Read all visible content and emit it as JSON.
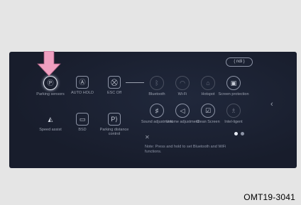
{
  "top_button": "( ndi )",
  "left_items": [
    {
      "name": "parking-sensor",
      "icon": "parking-icon",
      "glyph": "Ⓟ",
      "label": "Parking sensors",
      "highlight": true
    },
    {
      "name": "auto-hold",
      "icon": "auto-hold-icon",
      "glyph": "Ⓐ",
      "label": "AUTO HOLD"
    },
    {
      "name": "esc-off",
      "icon": "esc-off-icon",
      "glyph": "⛒",
      "label": "ESC Off"
    },
    {
      "name": "speed-assist",
      "icon": "speed-assist-icon",
      "glyph": "◭",
      "label": "Speed assist"
    },
    {
      "name": "bsd",
      "icon": "bsd-icon",
      "glyph": "▭",
      "label": "BSD"
    },
    {
      "name": "parking-distance-control",
      "icon": "parking-distance-icon",
      "glyph": "P⟩",
      "label": "Parking distance control"
    }
  ],
  "right_items": [
    {
      "name": "bluetooth",
      "icon": "bluetooth-icon",
      "glyph": "ᛒ",
      "label": "Bluetooth",
      "dim": true
    },
    {
      "name": "wifi",
      "icon": "wifi-icon",
      "glyph": "◠",
      "label": "Wi-Fi",
      "dim": true
    },
    {
      "name": "hotspot",
      "icon": "hotspot-icon",
      "glyph": "⌂",
      "label": "Hotspot",
      "dim": true
    },
    {
      "name": "screen-protection",
      "icon": "screen-protection-icon",
      "glyph": "▣",
      "label": "Screen protection"
    },
    {
      "name": "sound-adjustment",
      "icon": "sound-adjustment-icon",
      "glyph": "♯",
      "label": "Sound adjustment"
    },
    {
      "name": "volume-adjustment",
      "icon": "volume-icon",
      "glyph": "◁",
      "label": "Volume adjustment"
    },
    {
      "name": "clean-screen",
      "icon": "clean-screen-icon",
      "glyph": "☑",
      "label": "Clean Screen"
    },
    {
      "name": "intelligent",
      "icon": "intelligent-icon",
      "glyph": "♗",
      "label": "Intel-ligent",
      "dim": true
    }
  ],
  "close_icon": "close-icon",
  "note": "Note: Press and hold to set Bluetooth and WiFi functions.",
  "caption": "OMT19-3041",
  "colors": {
    "screen_bg": "#181d2c",
    "arrow": "#ef9fc0",
    "icon_border": "#8d94a6",
    "highlight": "#e8ecf5"
  }
}
